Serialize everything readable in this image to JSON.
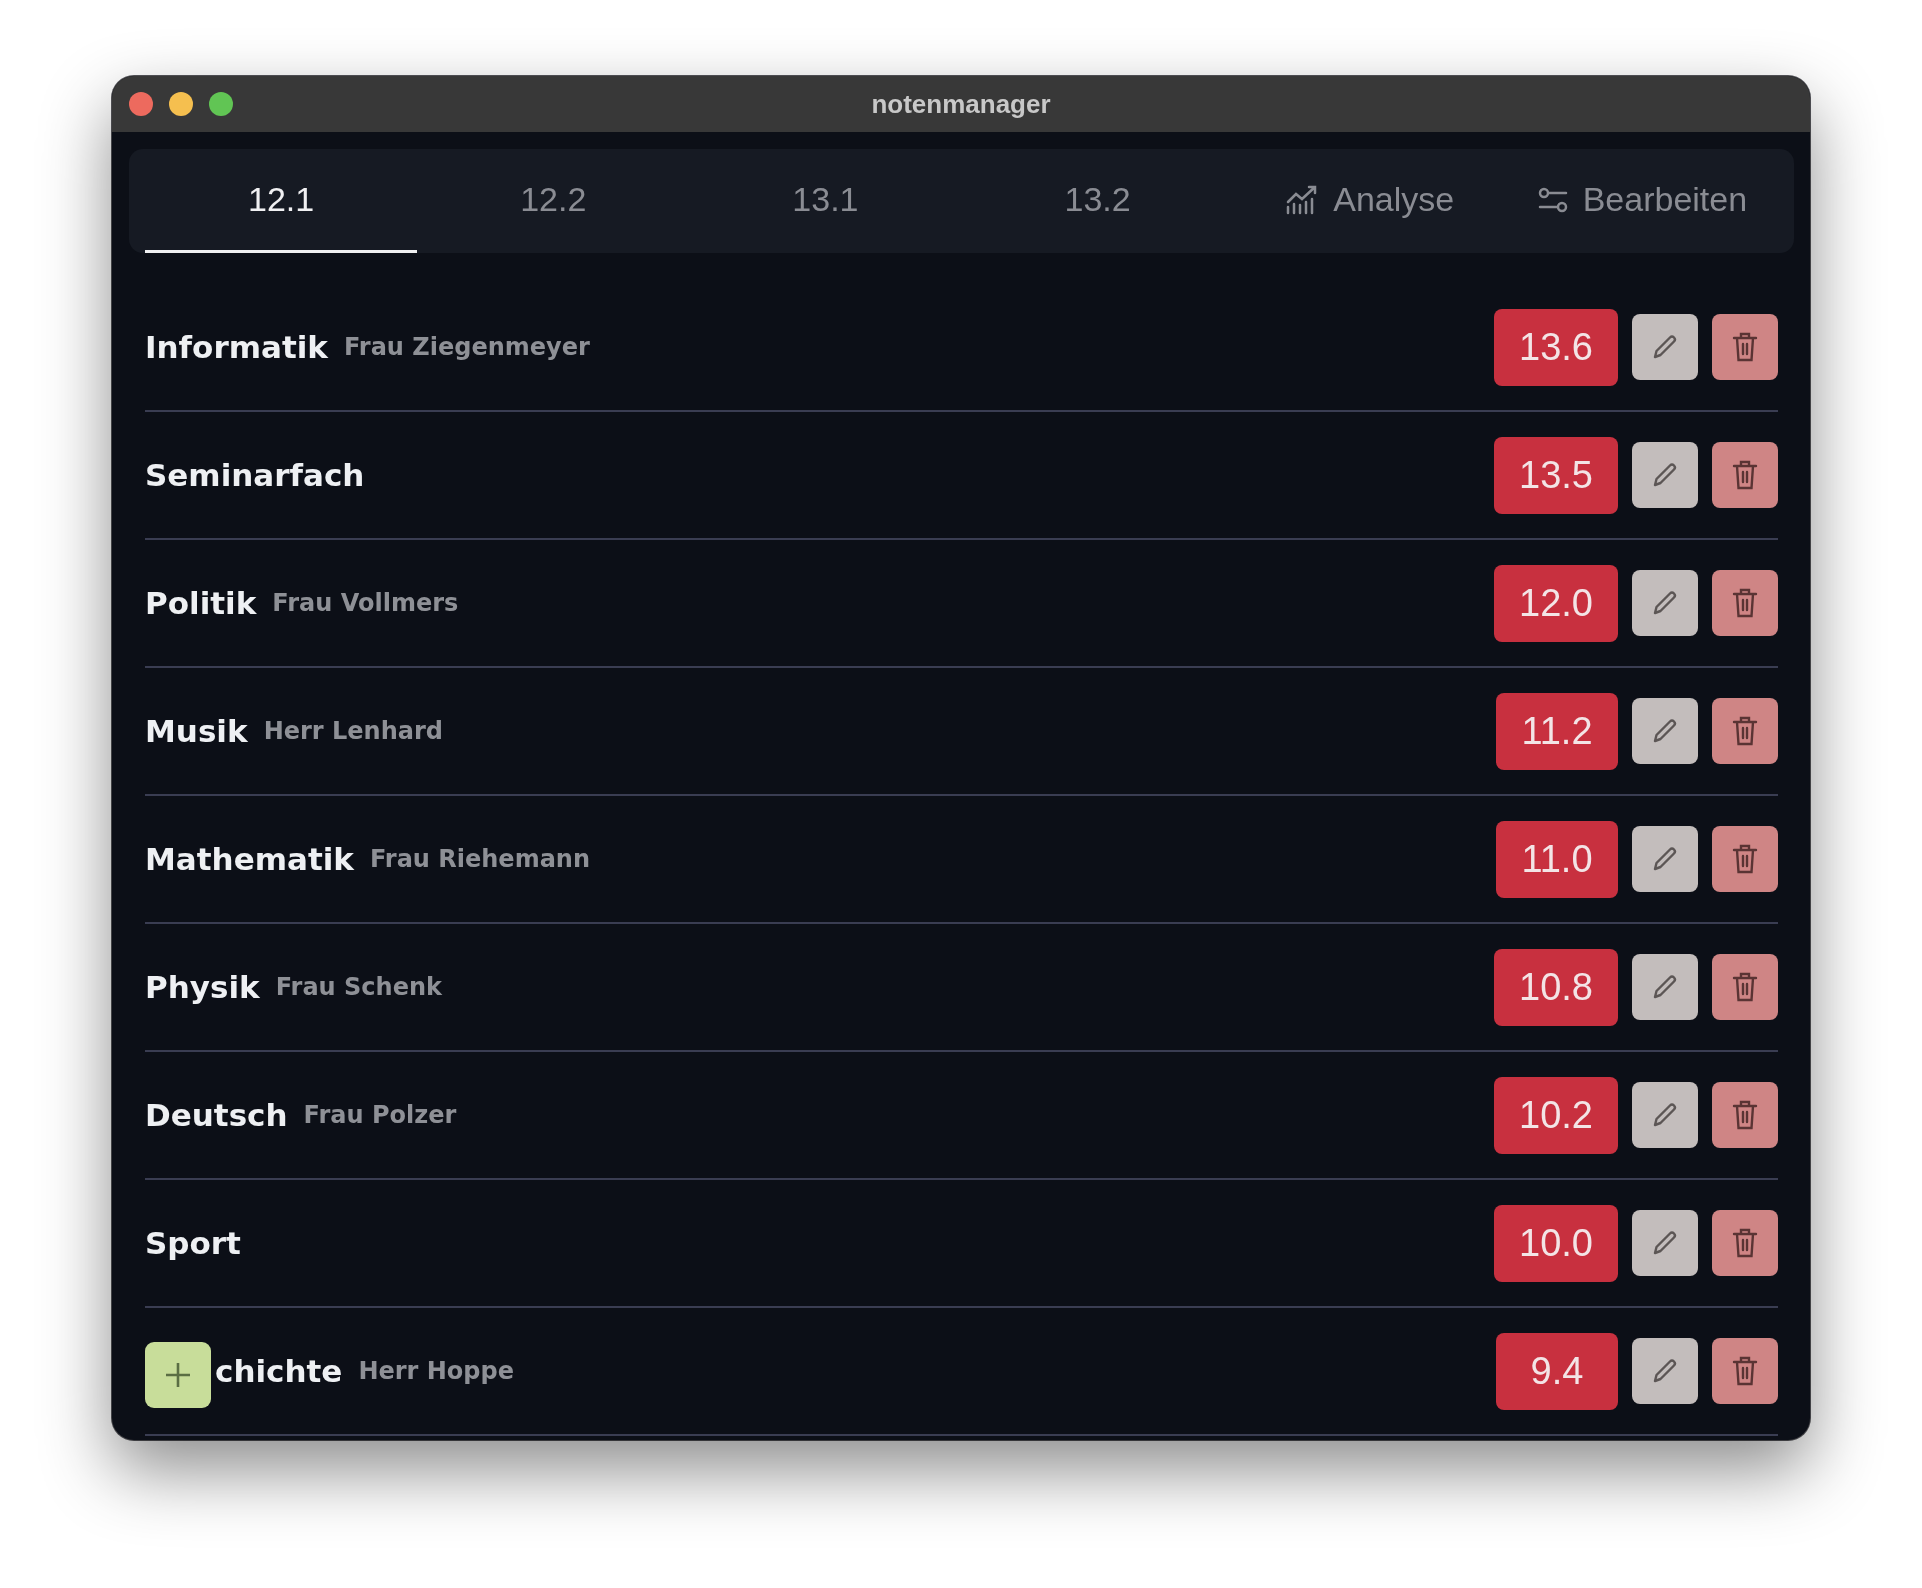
{
  "window": {
    "title": "notenmanager"
  },
  "tabs": [
    {
      "label": "12.1",
      "selected": true
    },
    {
      "label": "12.2",
      "selected": false
    },
    {
      "label": "13.1",
      "selected": false
    },
    {
      "label": "13.2",
      "selected": false
    },
    {
      "label": "Analyse",
      "selected": false,
      "kind": "chart"
    },
    {
      "label": "Bearbeiten",
      "selected": false,
      "kind": "sliders"
    }
  ],
  "subjects": [
    {
      "name": "Informatik",
      "teacher": "Frau Ziegenmeyer",
      "grade": "13.6"
    },
    {
      "name": "Seminarfach",
      "grade": "13.5"
    },
    {
      "name": "Politik",
      "teacher": "Frau Vollmers",
      "grade": "12.0"
    },
    {
      "name": "Musik",
      "teacher": "Herr Lenhard",
      "grade": "11.2"
    },
    {
      "name": "Mathematik",
      "teacher": "Frau Riehemann",
      "grade": "11.0"
    },
    {
      "name": "Physik",
      "teacher": "Frau Schenk",
      "grade": "10.8"
    },
    {
      "name": "Deutsch",
      "teacher": "Frau Polzer",
      "grade": "10.2"
    },
    {
      "name": "Sport",
      "grade": "10.0"
    },
    {
      "name": "chichte",
      "teacher": "Herr Hoppe",
      "grade": "9.4"
    }
  ]
}
